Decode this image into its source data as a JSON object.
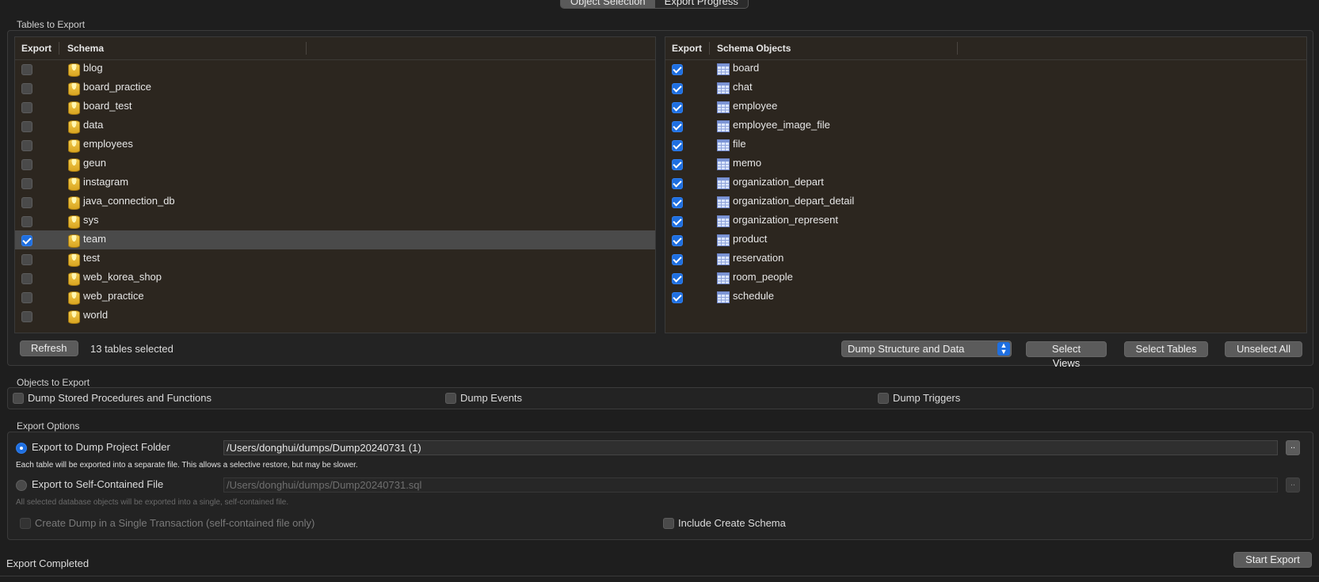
{
  "tabs": [
    "Object Selection",
    "Export Progress"
  ],
  "tables_to_export": {
    "section_label": "Tables to Export",
    "left": {
      "headers": [
        "Export",
        "Schema"
      ],
      "rows": [
        {
          "name": "blog",
          "checked": false,
          "selected": false
        },
        {
          "name": "board_practice",
          "checked": false,
          "selected": false
        },
        {
          "name": "board_test",
          "checked": false,
          "selected": false
        },
        {
          "name": "data",
          "checked": false,
          "selected": false
        },
        {
          "name": "employees",
          "checked": false,
          "selected": false
        },
        {
          "name": "geun",
          "checked": false,
          "selected": false
        },
        {
          "name": "instagram",
          "checked": false,
          "selected": false
        },
        {
          "name": "java_connection_db",
          "checked": false,
          "selected": false
        },
        {
          "name": "sys",
          "checked": false,
          "selected": false
        },
        {
          "name": "team",
          "checked": true,
          "selected": true
        },
        {
          "name": "test",
          "checked": false,
          "selected": false
        },
        {
          "name": "web_korea_shop",
          "checked": false,
          "selected": false
        },
        {
          "name": "web_practice",
          "checked": false,
          "selected": false
        },
        {
          "name": "world",
          "checked": false,
          "selected": false
        }
      ]
    },
    "right": {
      "headers": [
        "Export",
        "Schema Objects"
      ],
      "rows": [
        {
          "name": "board",
          "checked": true
        },
        {
          "name": "chat",
          "checked": true
        },
        {
          "name": "employee",
          "checked": true
        },
        {
          "name": "employee_image_file",
          "checked": true
        },
        {
          "name": "file",
          "checked": true
        },
        {
          "name": "memo",
          "checked": true
        },
        {
          "name": "organization_depart",
          "checked": true
        },
        {
          "name": "organization_depart_detail",
          "checked": true
        },
        {
          "name": "organization_represent",
          "checked": true
        },
        {
          "name": "product",
          "checked": true
        },
        {
          "name": "reservation",
          "checked": true
        },
        {
          "name": "room_people",
          "checked": true
        },
        {
          "name": "schedule",
          "checked": true
        }
      ]
    },
    "refresh_label": "Refresh",
    "selected_count": "13 tables selected",
    "dump_mode": "Dump Structure and Data",
    "select_views_label": "Select Views",
    "select_tables_label": "Select Tables",
    "unselect_all_label": "Unselect All"
  },
  "objects_to_export": {
    "section_label": "Objects to Export",
    "stored_procedures": "Dump Stored Procedures and Functions",
    "events": "Dump Events",
    "triggers": "Dump Triggers"
  },
  "export_options": {
    "section_label": "Export Options",
    "folder_option": "Export to Dump Project Folder",
    "folder_path": "/Users/donghui/dumps/Dump20240731 (1)",
    "folder_note": "Each table will be exported into a separate file. This allows a selective restore, but may be slower.",
    "file_option": "Export to Self-Contained File",
    "file_path": "/Users/donghui/dumps/Dump20240731.sql",
    "file_note": "All selected database objects will be exported into a single, self-contained file.",
    "browse_label": "..",
    "single_transaction": "Create Dump in a Single Transaction (self-contained file only)",
    "include_schema": "Include Create Schema"
  },
  "status_text": "Export Completed",
  "start_export_label": "Start Export"
}
